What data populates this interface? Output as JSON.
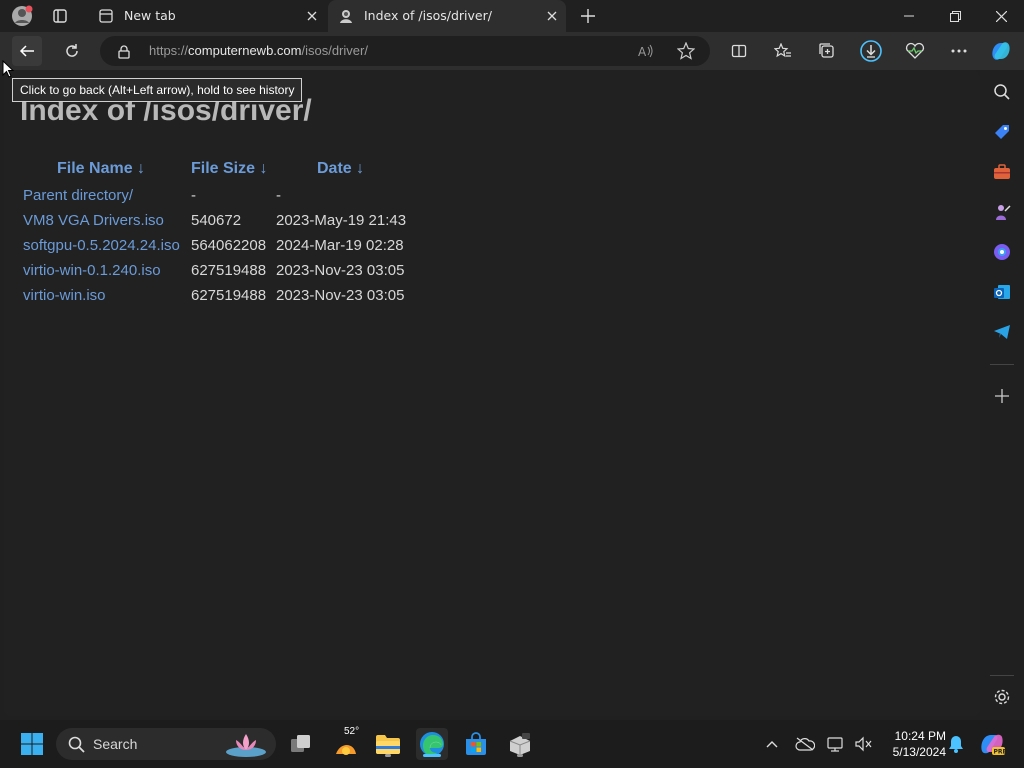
{
  "tabs": [
    {
      "title": "New tab"
    },
    {
      "title": "Index of /isos/driver/"
    }
  ],
  "address": {
    "scheme": "https://",
    "host": "computernewb.com",
    "path": "/isos/driver/"
  },
  "tooltip": "Click to go back (Alt+Left arrow), hold to see history",
  "page": {
    "title": "Index of /isos/driver/",
    "headers": [
      "File Name  ↓",
      "File Size  ↓",
      "Date  ↓"
    ],
    "rows": [
      {
        "name": "Parent directory/",
        "size": "-",
        "date": "-"
      },
      {
        "name": "VM8 VGA Drivers.iso",
        "size": "540672",
        "date": "2023-May-19 21:43"
      },
      {
        "name": "softgpu-0.5.2024.24.iso",
        "size": "564062208",
        "date": "2024-Mar-19 02:28"
      },
      {
        "name": "virtio-win-0.1.240.iso",
        "size": "627519488",
        "date": "2023-Nov-23 03:05"
      },
      {
        "name": "virtio-win.iso",
        "size": "627519488",
        "date": "2023-Nov-23 03:05"
      }
    ]
  },
  "taskbar": {
    "search": "Search",
    "weather": "52°",
    "time": "10:24 PM",
    "date": "5/13/2024"
  },
  "colors": {
    "link": "#6b9bd8",
    "accent": "#4cc2ff"
  }
}
